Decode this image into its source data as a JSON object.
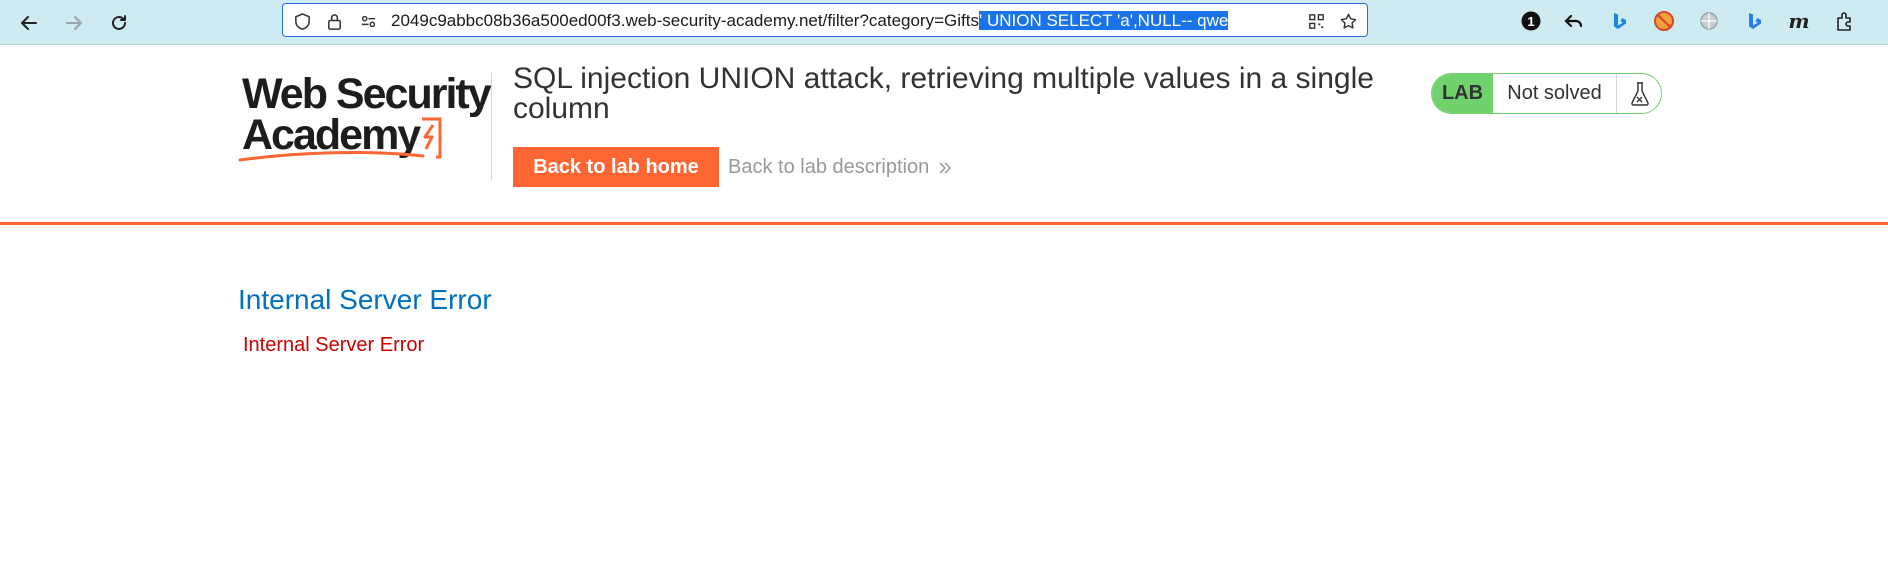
{
  "browser": {
    "url_plain": "2049c9abbc08b36a500ed00f3.web-security-academy.net/filter?category=Gifts",
    "url_selected": "' UNION SELECT 'a',NULL-- qwe",
    "extension_badge_count": "1",
    "extension_m_label": "m"
  },
  "logo": {
    "line1": "Web Security",
    "line2": "Academy",
    "colors": {
      "text": "#1d1d1b",
      "accent": "#ff6633"
    }
  },
  "lab": {
    "title": "SQL injection UNION attack, retrieving multiple values in a single column",
    "back_home_label": "Back to lab home",
    "back_description_label": "Back to lab description",
    "status_badge": "LAB",
    "status_text": "Not solved",
    "colors": {
      "accent": "#ff6633",
      "badge": "#70d16d"
    }
  },
  "content": {
    "heading": "Internal Server Error",
    "message": "Internal Server Error",
    "colors": {
      "heading": "#0071bc",
      "message": "#cc0000"
    }
  }
}
